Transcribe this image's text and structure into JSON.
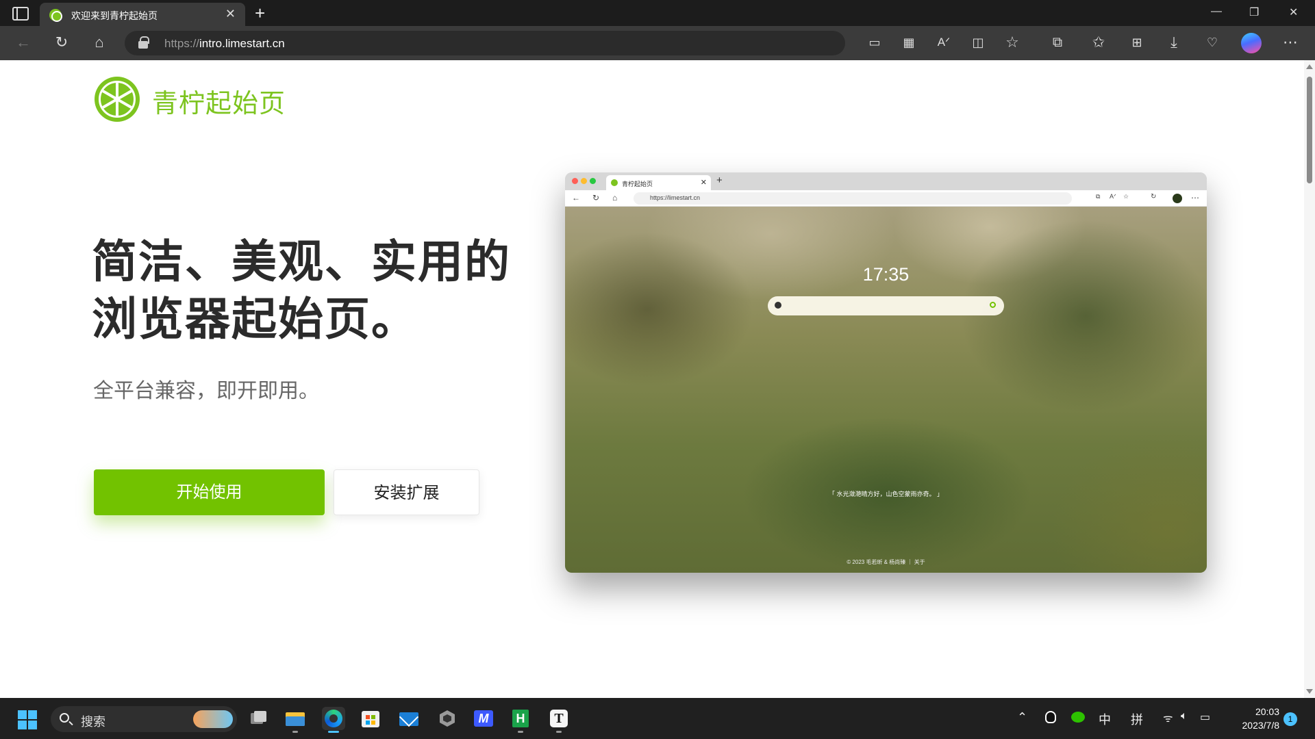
{
  "browser": {
    "tab_title": "欢迎来到青柠起始页",
    "tab_close": "✕",
    "new_tab": "+",
    "url_scheme": "https://",
    "url_host": "intro.limestart.cn",
    "window_controls": {
      "minimize": "—",
      "restore": "❐",
      "close": "✕"
    },
    "toolbar_icons": [
      "back-icon",
      "refresh-icon",
      "home-icon",
      "device-icon",
      "apps-icon",
      "read-aloud-icon",
      "split-screen-icon",
      "favorite-star-icon",
      "extensions-icon",
      "favorites-icon",
      "collections-icon",
      "download-icon",
      "health-icon",
      "profile-avatar",
      "more-icon"
    ]
  },
  "page": {
    "brand": "青柠起始页",
    "headline_line1": "简洁、美观、实用的",
    "headline_line2": "浏览器起始页。",
    "subhead": "全平台兼容，即开即用。",
    "primary_button": "开始使用",
    "secondary_button": "安装扩展",
    "brand_color": "#72c200"
  },
  "mock": {
    "tab_title": "青柠起始页",
    "url": "https://limestart.cn",
    "clock": "17:35",
    "quote": "「 水光潋滟晴方好，山色空蒙雨亦奇。 」",
    "footer": "© 2023 毛若昕 & 杨尚臻 ｜ 关于"
  },
  "taskbar": {
    "search_placeholder": "搜索",
    "tray_ime_cn": "中",
    "tray_ime_pinyin": "拼",
    "time": "20:03",
    "date": "2023/7/8",
    "notification_count": "1",
    "apps": [
      "file-explorer",
      "edge-browser",
      "microsoft-store",
      "mail",
      "unity-hub",
      "app-m",
      "hbuilder",
      "typora"
    ]
  }
}
